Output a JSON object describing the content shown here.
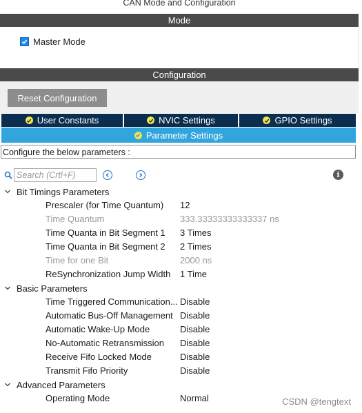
{
  "window": {
    "title": "CAN Mode and Configuration"
  },
  "mode": {
    "header": "Mode",
    "master_mode": {
      "label": "Master Mode",
      "checked": true
    }
  },
  "configuration": {
    "header": "Configuration",
    "reset_button": "Reset Configuration",
    "tabs": [
      {
        "label": "User Constants",
        "icon": "check-circle-icon"
      },
      {
        "label": "NVIC Settings",
        "icon": "check-circle-icon"
      },
      {
        "label": "GPIO Settings",
        "icon": "check-circle-icon"
      }
    ],
    "active_tab": {
      "label": "Parameter Settings",
      "icon": "check-circle-icon"
    },
    "description": "Configure the below parameters :",
    "search": {
      "placeholder": "Search (Crtl+F)"
    }
  },
  "groups": [
    {
      "label": "Bit Timings Parameters",
      "params": [
        {
          "name": "Prescaler (for Time Quantum)",
          "value": "12",
          "disabled": false
        },
        {
          "name": "Time Quantum",
          "value": "333.33333333333337 ns",
          "disabled": true
        },
        {
          "name": "Time Quanta in Bit Segment 1",
          "value": "3 Times",
          "disabled": false
        },
        {
          "name": "Time Quanta in Bit Segment 2",
          "value": "2 Times",
          "disabled": false
        },
        {
          "name": "Time for one Bit",
          "value": "2000 ns",
          "disabled": true
        },
        {
          "name": "ReSynchronization Jump Width",
          "value": "1 Time",
          "disabled": false
        }
      ]
    },
    {
      "label": "Basic Parameters",
      "params": [
        {
          "name": "Time Triggered Communication...",
          "value": "Disable",
          "disabled": false
        },
        {
          "name": "Automatic Bus-Off Management",
          "value": "Disable",
          "disabled": false
        },
        {
          "name": "Automatic Wake-Up Mode",
          "value": "Disable",
          "disabled": false
        },
        {
          "name": "No-Automatic Retransmission",
          "value": "Disable",
          "disabled": false
        },
        {
          "name": "Receive Fifo Locked Mode",
          "value": "Disable",
          "disabled": false
        },
        {
          "name": "Transmit Fifo Priority",
          "value": "Disable",
          "disabled": false
        }
      ]
    },
    {
      "label": "Advanced Parameters",
      "params": [
        {
          "name": "Operating Mode",
          "value": "Normal",
          "disabled": false
        }
      ]
    }
  ],
  "watermark": "CSDN @tengtext",
  "colors": {
    "section_bar": "#4a4a4a",
    "tab_dark": "#0b2d4e",
    "tab_active": "#32a5dc",
    "check_yellow": "#f1e34e",
    "disabled_text": "#9a9a9a",
    "reset_button": "#8d8d8d"
  }
}
